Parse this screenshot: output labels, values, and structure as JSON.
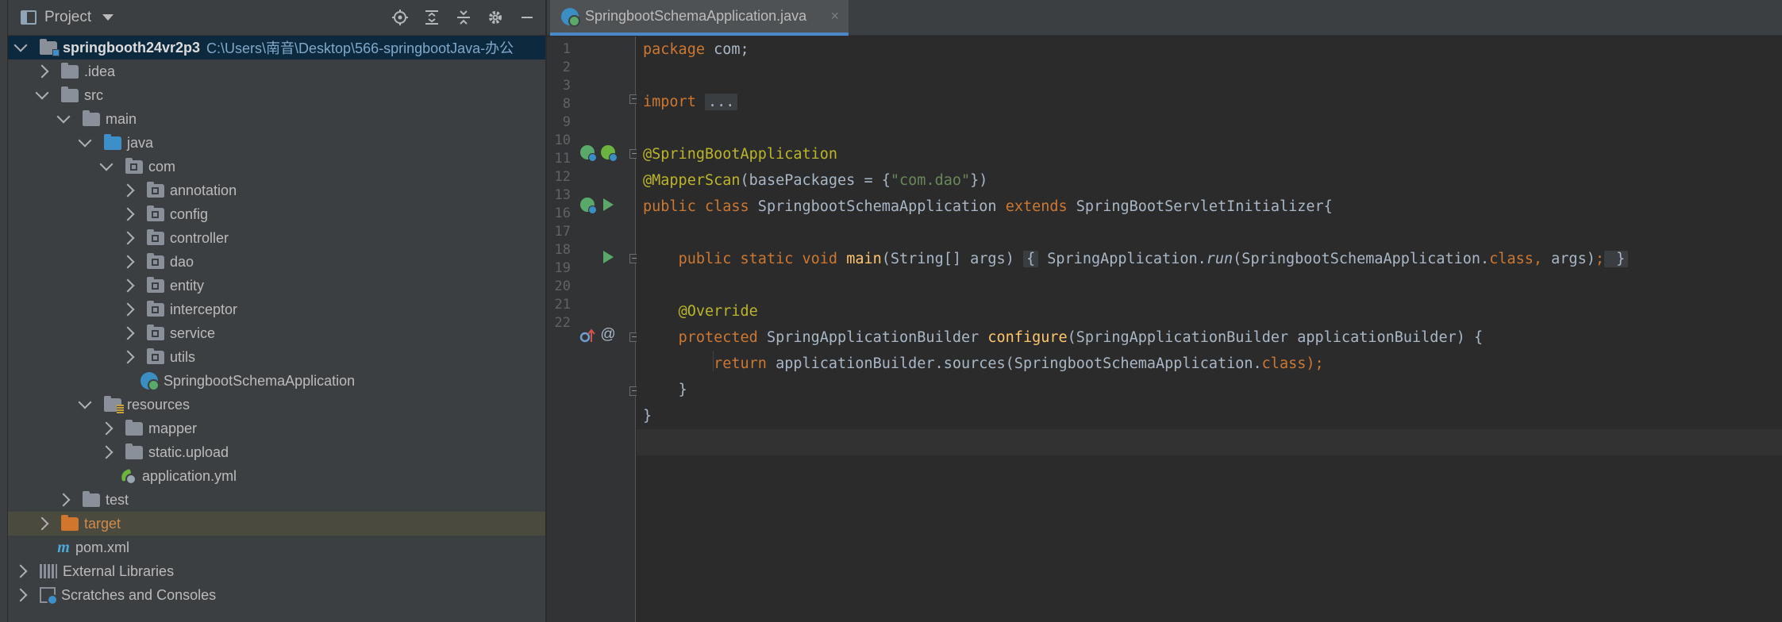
{
  "project_panel": {
    "title": "Project",
    "tools": [
      "locate-icon",
      "expand-all-icon",
      "collapse-all-icon",
      "gear-icon",
      "minimize-icon"
    ],
    "tree": [
      {
        "id": "root",
        "label": "springbooth24vr2p3",
        "path": "C:\\Users\\南音\\Desktop\\566-springbootJava-办公",
        "depth": 0,
        "expanded": true,
        "icon": "module-folder-icon",
        "bold": true,
        "selected": true
      },
      {
        "id": "idea",
        "label": ".idea",
        "depth": 1,
        "expanded": false,
        "icon": "folder-icon"
      },
      {
        "id": "src",
        "label": "src",
        "depth": 1,
        "expanded": true,
        "icon": "folder-icon"
      },
      {
        "id": "main",
        "label": "main",
        "depth": 2,
        "expanded": true,
        "icon": "folder-icon"
      },
      {
        "id": "java",
        "label": "java",
        "depth": 3,
        "expanded": true,
        "icon": "source-folder-icon"
      },
      {
        "id": "com",
        "label": "com",
        "depth": 4,
        "expanded": true,
        "icon": "package-icon"
      },
      {
        "id": "annotation",
        "label": "annotation",
        "depth": 5,
        "expanded": false,
        "icon": "package-icon"
      },
      {
        "id": "config",
        "label": "config",
        "depth": 5,
        "expanded": false,
        "icon": "package-icon"
      },
      {
        "id": "controller",
        "label": "controller",
        "depth": 5,
        "expanded": false,
        "icon": "package-icon"
      },
      {
        "id": "dao",
        "label": "dao",
        "depth": 5,
        "expanded": false,
        "icon": "package-icon"
      },
      {
        "id": "entity",
        "label": "entity",
        "depth": 5,
        "expanded": false,
        "icon": "package-icon"
      },
      {
        "id": "interceptor",
        "label": "interceptor",
        "depth": 5,
        "expanded": false,
        "icon": "package-icon"
      },
      {
        "id": "service",
        "label": "service",
        "depth": 5,
        "expanded": false,
        "icon": "package-icon"
      },
      {
        "id": "utils",
        "label": "utils",
        "depth": 5,
        "expanded": false,
        "icon": "package-icon"
      },
      {
        "id": "app",
        "label": "SpringbootSchemaApplication",
        "depth": 5,
        "leaf": true,
        "icon": "spring-class-icon"
      },
      {
        "id": "resources",
        "label": "resources",
        "depth": 3,
        "expanded": true,
        "icon": "resources-folder-icon"
      },
      {
        "id": "mapper",
        "label": "mapper",
        "depth": 4,
        "expanded": false,
        "icon": "folder-icon"
      },
      {
        "id": "static",
        "label": "static.upload",
        "depth": 4,
        "expanded": false,
        "icon": "folder-icon"
      },
      {
        "id": "appyml",
        "label": "application.yml",
        "depth": 4,
        "leaf": true,
        "icon": "yaml-file-icon"
      },
      {
        "id": "test",
        "label": "test",
        "depth": 2,
        "expanded": false,
        "icon": "folder-icon"
      },
      {
        "id": "target",
        "label": "target",
        "depth": 1,
        "expanded": false,
        "icon": "excluded-folder-icon",
        "highlight": true
      },
      {
        "id": "pom",
        "label": "pom.xml",
        "depth": 1,
        "leaf": true,
        "icon": "maven-icon"
      },
      {
        "id": "extlibs",
        "label": "External Libraries",
        "depth": 0,
        "expanded": false,
        "icon": "libraries-icon"
      },
      {
        "id": "scratches",
        "label": "Scratches and Consoles",
        "depth": 0,
        "expanded": false,
        "icon": "scratches-icon"
      }
    ]
  },
  "editor": {
    "tab": {
      "name": "SpringbootSchemaApplication.java",
      "close": "×"
    },
    "line_numbers": [
      "1",
      "2",
      "3",
      "8",
      "9",
      "10",
      "11",
      "12",
      "13",
      "16",
      "17",
      "18",
      "19",
      "20",
      "21",
      "22"
    ],
    "code": {
      "l1": {
        "kw": "package",
        "rest": " com;"
      },
      "l3": {
        "kw": "import",
        "fold": "..."
      },
      "l9": {
        "ann": "@SpringBootApplication"
      },
      "l10": {
        "ann": "@MapperScan",
        "a": "(basePackages = {",
        "str": "\"com.dao\"",
        "b": "})"
      },
      "l11": {
        "kw1": "public",
        "kw2": "class",
        "name": " SpringbootSchemaApplication ",
        "kw3": "extends",
        "rest": " SpringBootServletInitializer{"
      },
      "l13": {
        "kw1": "public",
        "kw2": "static",
        "kw3": "void",
        "fn": "main",
        "a": "(String[] args) ",
        "fold_open": "{",
        "b": " SpringApplication.",
        "run": "run",
        "c": "(SpringbootSchemaApplication.",
        "kw4": "class,",
        "d": " args)",
        "semi": ";",
        "fold_close": " }"
      },
      "l17": {
        "ann": "@Override"
      },
      "l18": {
        "kw": "protected",
        "a": " SpringApplicationBuilder ",
        "fn": "configure",
        "b": "(SpringApplicationBuilder applicationBuilder) {"
      },
      "l19": {
        "kw": "return",
        "a": " applicationBuilder.sources(SpringbootSchemaApplication.",
        "kw2": "class",
        "b": ");"
      },
      "l20": {
        "a": "}"
      },
      "l21": {
        "a": "}"
      }
    },
    "gutter_icons": {
      "l9": [
        "spring-bean-icon",
        "spring-boot-icon"
      ],
      "l11": [
        "spring-bean-icon",
        "run-icon"
      ],
      "l13": [
        "run-icon"
      ],
      "l18": [
        "override-method-icon",
        "at-icon"
      ]
    },
    "gutter_text": {
      "at": "@"
    }
  }
}
